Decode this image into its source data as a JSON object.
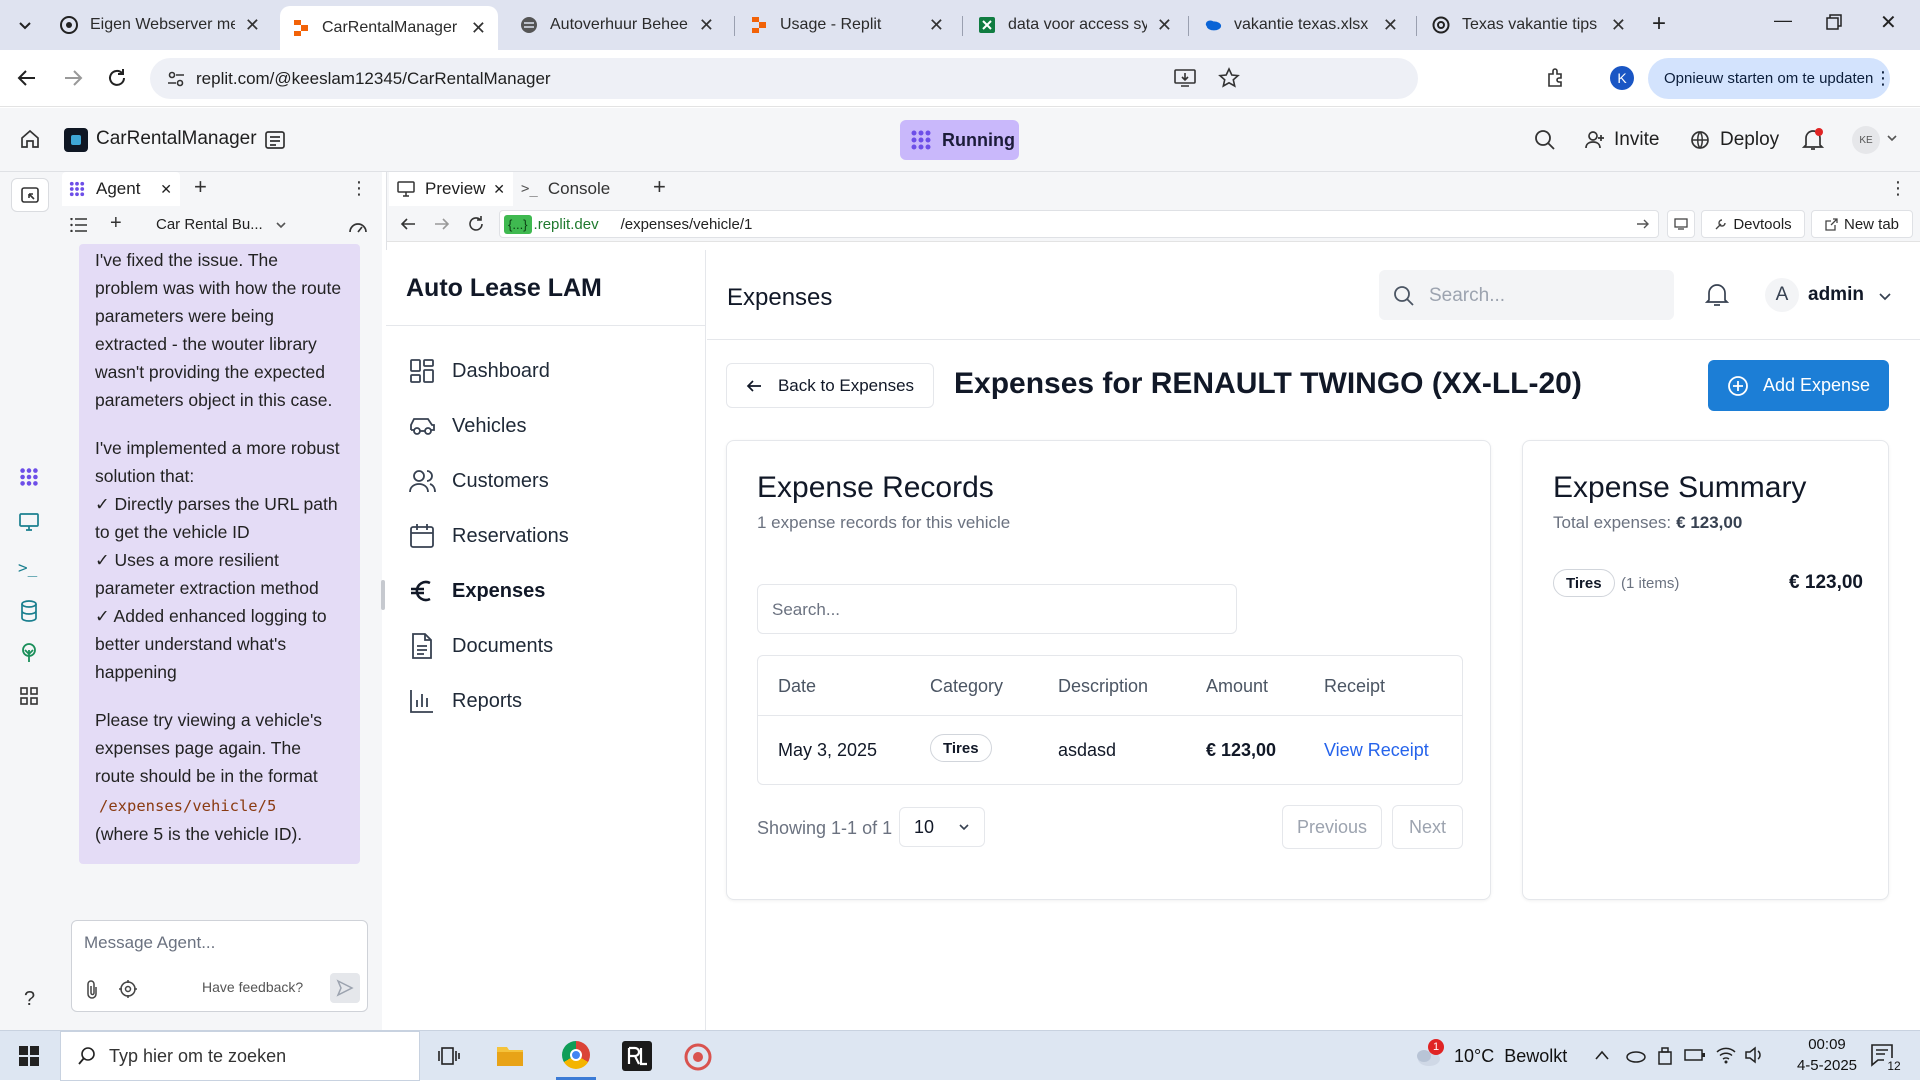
{
  "browser": {
    "tabs": [
      {
        "title": "Eigen Webserver met"
      },
      {
        "title": "CarRentalManager - R"
      },
      {
        "title": "Autoverhuur Beheer"
      },
      {
        "title": "Usage - Replit"
      },
      {
        "title": "data voor access syst"
      },
      {
        "title": "vakantie texas.xlsx"
      },
      {
        "title": "Texas vakantie tips"
      }
    ],
    "url": "replit.com/@keeslam12345/CarRentalManager",
    "profile_initial": "K",
    "update_label": "Opnieuw starten om te updaten"
  },
  "replit": {
    "project_name": "CarRentalManager",
    "run_status": "Running",
    "invite_label": "Invite",
    "deploy_label": "Deploy",
    "avatar_initials": "KE"
  },
  "agent": {
    "tab_label": "Agent",
    "chat_title": "Car Rental Bu...",
    "message": {
      "p1": "I've fixed the issue. The problem was with how the route parameters were being extracted - the wouter library wasn't providing the expected parameters object in this case.",
      "p2": "I've implemented a more robust solution that:",
      "items": [
        "✓ Directly parses the URL path to get the vehicle ID",
        "✓ Uses a more resilient parameter extraction method",
        "✓ Added enhanced logging to better understand what's happening"
      ],
      "p3_a": "Please try viewing a vehicle's expenses page again. The route should be in the format",
      "p3_code": "/expenses/vehicle/5",
      "p3_b": "(where 5 is the vehicle ID)."
    },
    "input_placeholder": "Message Agent...",
    "feedback_label": "Have feedback?"
  },
  "preview": {
    "tabs": [
      {
        "label": "Preview"
      },
      {
        "label": "Console"
      }
    ],
    "domain_badge": "{...}",
    "domain": ".replit.dev",
    "path": "/expenses/vehicle/1",
    "devtools_label": "Devtools",
    "newtab_label": "New tab"
  },
  "app": {
    "brand": "Auto Lease LAM",
    "nav": [
      {
        "label": "Dashboard",
        "icon": "dashboard-icon"
      },
      {
        "label": "Vehicles",
        "icon": "car-icon"
      },
      {
        "label": "Customers",
        "icon": "users-icon"
      },
      {
        "label": "Reservations",
        "icon": "calendar-icon"
      },
      {
        "label": "Expenses",
        "icon": "euro-icon"
      },
      {
        "label": "Documents",
        "icon": "document-icon"
      },
      {
        "label": "Reports",
        "icon": "chart-icon"
      }
    ],
    "page_title": "Expenses",
    "search_placeholder": "Search...",
    "user_initial": "A",
    "user_name": "admin",
    "back_label": "Back to Expenses",
    "heading": "Expenses for RENAULT TWINGO (XX-LL-20)",
    "add_label": "Add Expense",
    "records": {
      "title": "Expense Records",
      "subtitle": "1 expense records for this vehicle",
      "search_placeholder": "Search...",
      "columns": [
        "Date",
        "Category",
        "Description",
        "Amount",
        "Receipt"
      ],
      "rows": [
        {
          "date": "May 3, 2025",
          "category": "Tires",
          "description": "asdasd",
          "amount": "€ 123,00",
          "receipt": "View Receipt"
        }
      ],
      "showing": "Showing 1-1 of 1",
      "page_size": "10",
      "prev_label": "Previous",
      "next_label": "Next"
    },
    "summary": {
      "title": "Expense Summary",
      "total_label": "Total expenses:",
      "total_value": "€ 123,00",
      "items": [
        {
          "category": "Tires",
          "count": "(1 items)",
          "amount": "€ 123,00"
        }
      ]
    }
  },
  "taskbar": {
    "search_placeholder": "Typ hier om te zoeken",
    "weather": "10°C  Bewolkt",
    "weather_badge": "1",
    "time": "00:09",
    "date": "4-5-2025",
    "notification_count": "12"
  },
  "colors": {
    "accent": "#1c7ed6",
    "running_bg": "#c9b8fb",
    "agent_bubble": "#e4dcf6",
    "link": "#2563eb"
  }
}
